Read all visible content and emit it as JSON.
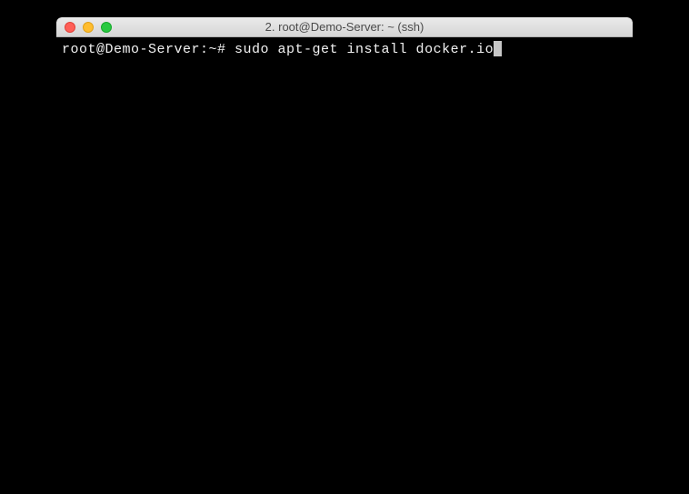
{
  "window": {
    "title": "2. root@Demo-Server: ~ (ssh)"
  },
  "terminal": {
    "prompt": "root@Demo-Server:~# ",
    "command": "sudo apt-get install docker.io"
  }
}
